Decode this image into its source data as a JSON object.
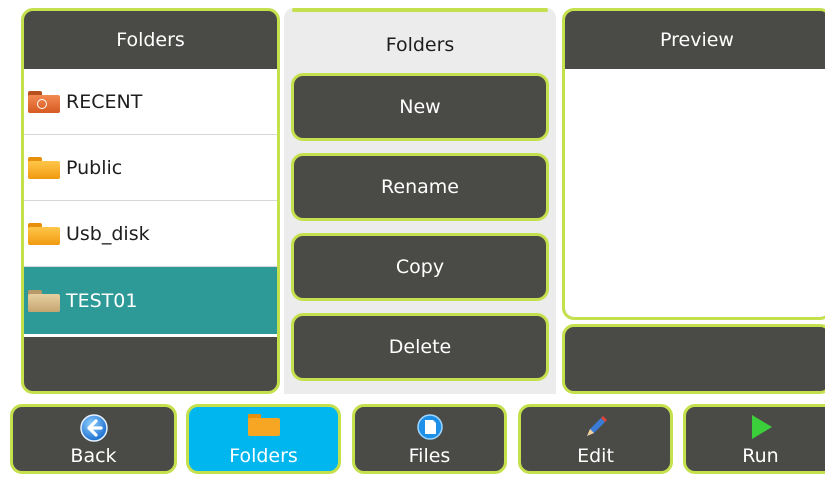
{
  "left_panel": {
    "title": "Folders",
    "folders": [
      {
        "name": "RECENT",
        "icon": "recent-folder-icon",
        "selected": false
      },
      {
        "name": "Public",
        "icon": "folder-icon",
        "selected": false
      },
      {
        "name": "Usb_disk",
        "icon": "folder-icon",
        "selected": false
      },
      {
        "name": "TEST01",
        "icon": "folder-icon",
        "selected": true
      }
    ]
  },
  "actions_panel": {
    "title": "Folders",
    "buttons": [
      "New",
      "Rename",
      "Copy",
      "Delete"
    ]
  },
  "preview_panel": {
    "title": "Preview"
  },
  "bottom_nav": {
    "back": "Back",
    "folders": "Folders",
    "files": "Files",
    "edit": "Edit",
    "run": "Run",
    "active": "folders"
  },
  "colors": {
    "panel_bg": "#4a4a47",
    "border_accent": "#c4e04c",
    "selected_row": "#2e9a98",
    "active_tab": "#00b6ee"
  }
}
